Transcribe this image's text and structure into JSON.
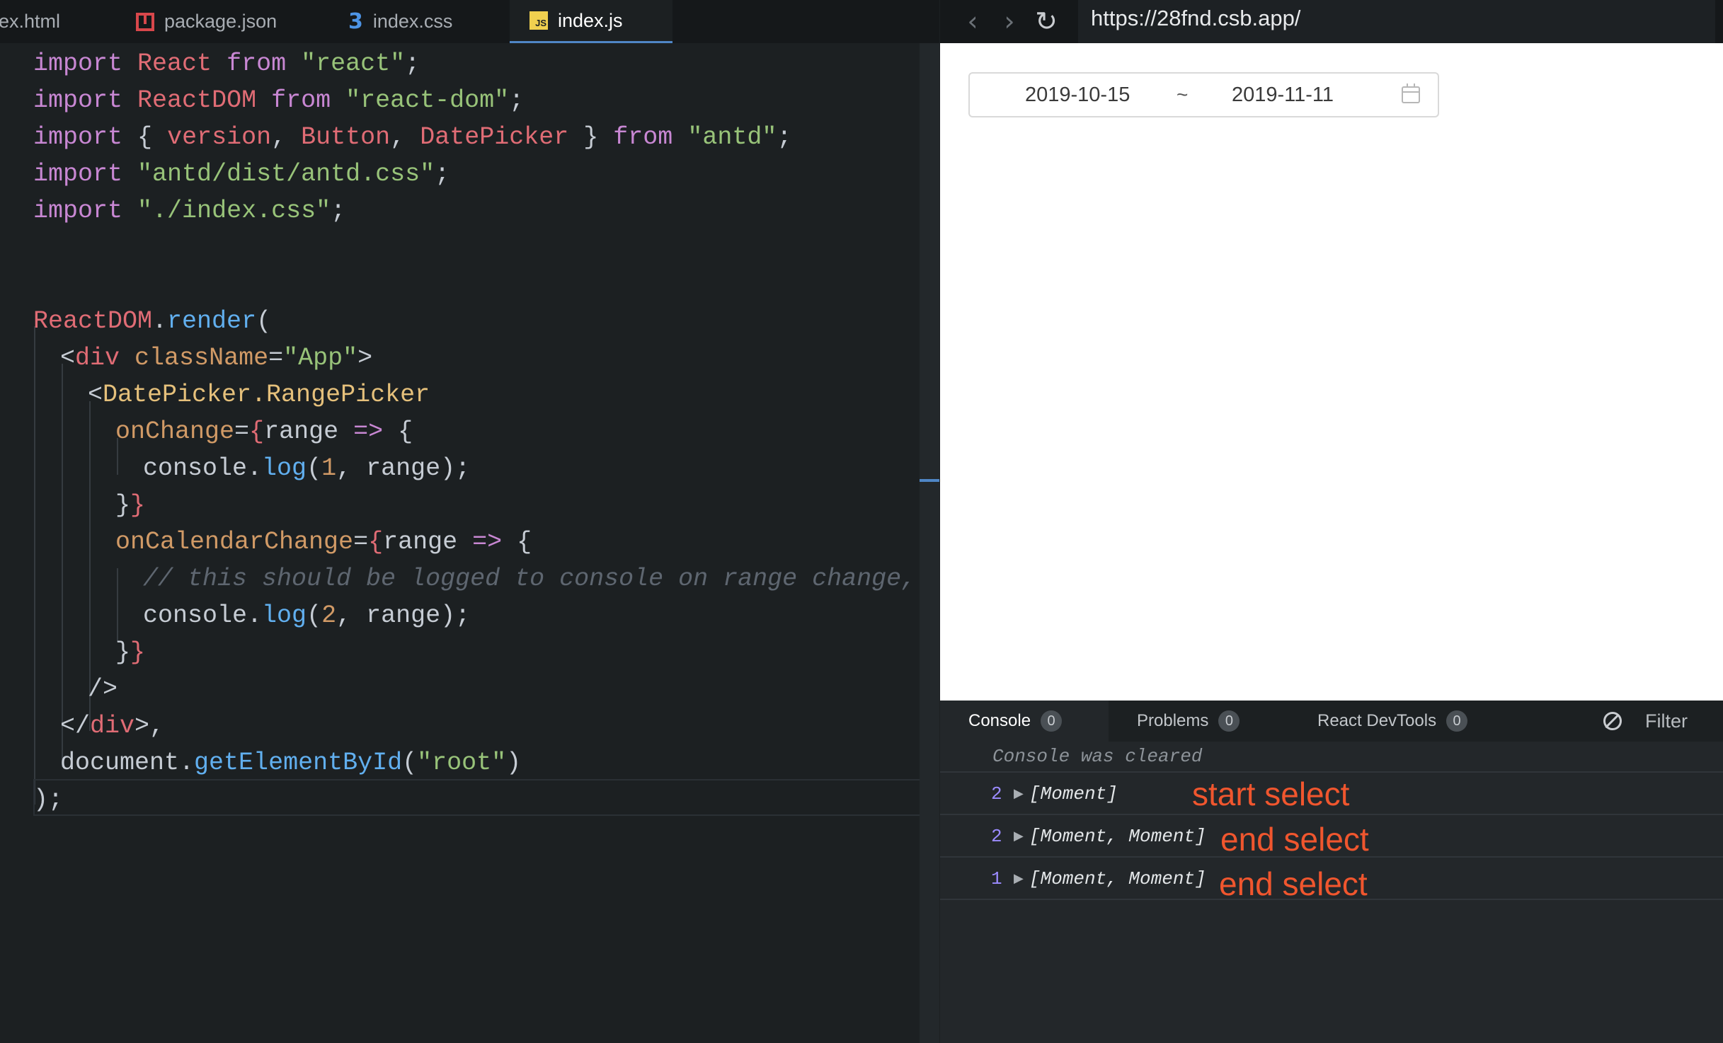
{
  "editor": {
    "tabs": [
      {
        "label": "lex.html",
        "icon": "html-file-icon"
      },
      {
        "label": "package.json",
        "icon": "json-file-icon"
      },
      {
        "label": "index.css",
        "icon": "css-file-icon"
      },
      {
        "label": "index.js",
        "icon": "js-file-icon",
        "active": true
      }
    ],
    "js_badge": "JS",
    "code": {
      "l1": {
        "a": "import",
        "b": "React",
        "c": "from",
        "d": "\"react\"",
        "e": ";"
      },
      "l2": {
        "a": "import",
        "b": "ReactDOM",
        "c": "from",
        "d": "\"react-dom\"",
        "e": ";"
      },
      "l3": {
        "a": "import",
        "b": "{",
        "c": "version",
        "d": ",",
        "e": "Button",
        "f": ",",
        "g": "DatePicker",
        "h": "}",
        "i": "from",
        "j": "\"antd\"",
        "k": ";"
      },
      "l4": {
        "a": "import",
        "b": "\"antd/dist/antd.css\"",
        "c": ";"
      },
      "l5": {
        "a": "import",
        "b": "\"./index.css\"",
        "c": ";"
      },
      "l7": {
        "a": "ReactDOM",
        "b": ".",
        "c": "render",
        "d": "("
      },
      "l8": {
        "a": "<",
        "b": "div",
        "c": "className",
        "d": "=",
        "e": "\"App\"",
        "f": ">"
      },
      "l9": {
        "a": "<",
        "b": "DatePicker.RangePicker"
      },
      "l10": {
        "a": "onChange",
        "b": "=",
        "c": "{",
        "d": "range",
        "e": "=>",
        "f": "{"
      },
      "l11": {
        "a": "console",
        "b": ".",
        "c": "log",
        "d": "(",
        "e": "1",
        "f": ",",
        "g": "range",
        "h": ");"
      },
      "l12": {
        "a": "}",
        "b": "}"
      },
      "l13": {
        "a": "onCalendarChange",
        "b": "=",
        "c": "{",
        "d": "range",
        "e": "=>",
        "f": "{"
      },
      "l14": {
        "a": "// this should be logged to console on range change, but nc"
      },
      "l15": {
        "a": "console",
        "b": ".",
        "c": "log",
        "d": "(",
        "e": "2",
        "f": ",",
        "g": "range",
        "h": ");"
      },
      "l16": {
        "a": "}",
        "b": "}"
      },
      "l17": {
        "a": "/>"
      },
      "l18": {
        "a": "</",
        "b": "div",
        "c": ">,"
      },
      "l19": {
        "a": "document",
        "b": ".",
        "c": "getElementById",
        "d": "(",
        "e": "\"root\"",
        "f": ")"
      },
      "l20": {
        "a": ");"
      }
    }
  },
  "browser": {
    "back_glyph": "‹",
    "forward_glyph": "›",
    "reload_glyph": "↻",
    "url": "https://28fnd.csb.app/",
    "range_picker": {
      "start": "2019-10-15",
      "separator": "~",
      "end": "2019-11-11"
    }
  },
  "console": {
    "tabs": [
      {
        "label": "Console",
        "count": "0"
      },
      {
        "label": "Problems",
        "count": "0"
      },
      {
        "label": "React DevTools",
        "count": "0"
      }
    ],
    "filter_label": "Filter",
    "cleared_message": "Console was cleared",
    "logs": [
      {
        "count": "2",
        "arrow": "▶",
        "value": "[Moment]",
        "annotation": "start select"
      },
      {
        "count": "2",
        "arrow": "▶",
        "value": "[Moment, Moment]",
        "annotation": "end select"
      },
      {
        "count": "1",
        "arrow": "▶",
        "value": "[Moment, Moment]",
        "annotation": "end select"
      }
    ]
  },
  "colors": {
    "keyword": "#c887d3",
    "identifier": "#e06c75",
    "string": "#98c379",
    "function": "#61afef",
    "attribute": "#d19a66",
    "component": "#e5c07b",
    "annotation": "#f0562e",
    "active_tab_underline": "#4f86c6"
  }
}
